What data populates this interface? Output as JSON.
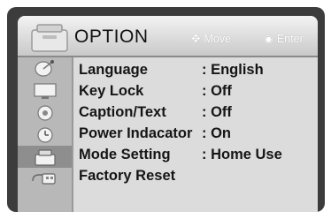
{
  "header": {
    "title": "OPTION",
    "hint_move_icon": "dpad-arrows-icon",
    "hint_move": "Move",
    "hint_enter_icon": "ok-button-icon",
    "hint_enter": "Enter"
  },
  "tabs": [
    {
      "icon": "satellite-dish-icon",
      "active": false
    },
    {
      "icon": "monitor-icon",
      "active": false
    },
    {
      "icon": "speaker-icon",
      "active": false
    },
    {
      "icon": "clock-icon",
      "active": false
    },
    {
      "icon": "option-box-icon",
      "active": true
    },
    {
      "icon": "usb-icon",
      "active": false
    }
  ],
  "items": [
    {
      "label": "Language",
      "value": ": English"
    },
    {
      "label": "Key Lock",
      "value": ": Off"
    },
    {
      "label": "Caption/Text",
      "value": ": Off"
    },
    {
      "label": "Power Indacator",
      "value": ": On"
    },
    {
      "label": "Mode Setting",
      "value": ": Home Use"
    },
    {
      "label": "Factory Reset",
      "value": ""
    }
  ],
  "colors": {
    "frame": "#3c3c3c",
    "panel": "#dcdcdc",
    "active_tab": "#8e8e8e",
    "text": "#151515"
  }
}
